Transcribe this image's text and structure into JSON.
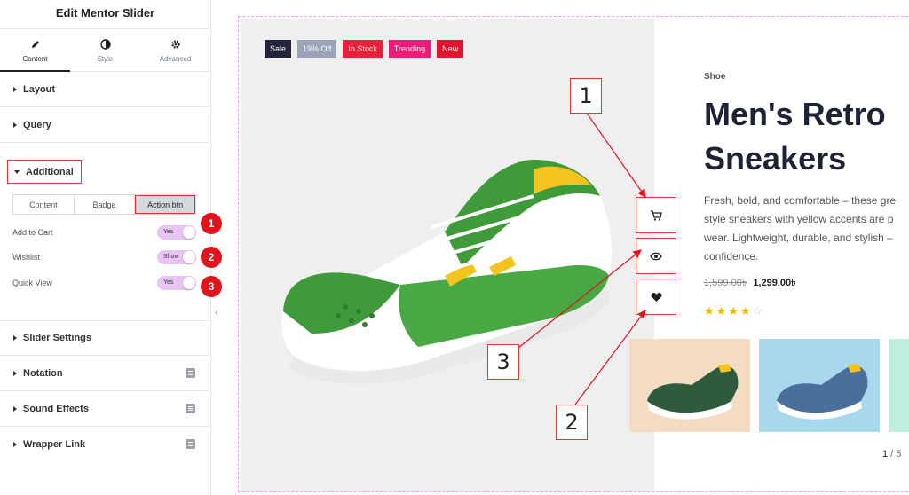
{
  "panel": {
    "title": "Edit Mentor Slider",
    "tabs": [
      {
        "label": "Content",
        "icon": "pencil-icon",
        "active": true
      },
      {
        "label": "Style",
        "icon": "contrast-icon",
        "active": false
      },
      {
        "label": "Advanced",
        "icon": "gear-icon",
        "active": false
      }
    ],
    "sections": {
      "layout": "Layout",
      "query": "Query",
      "additional": "Additional",
      "slider_settings": "Slider Settings",
      "notation": "Notation",
      "sound_effects": "Sound Effects",
      "wrapper_link": "Wrapper Link"
    },
    "subtabs": [
      "Content",
      "Badge",
      "Action btn"
    ],
    "controls": {
      "add_to_cart": {
        "label": "Add to Cart",
        "value": "Yes",
        "marker": "1"
      },
      "wishlist": {
        "label": "Wishlist",
        "value": "Show",
        "marker": "2"
      },
      "quick_view": {
        "label": "Quick View",
        "value": "Yes",
        "marker": "3"
      }
    },
    "collapse_glyph": "‹"
  },
  "preview": {
    "badges": [
      {
        "label": "Sale",
        "color": "#23233a"
      },
      {
        "label": "19% Off",
        "color": "#9aa3b8"
      },
      {
        "label": "In Stock",
        "color": "#e8213a"
      },
      {
        "label": "Trending",
        "color": "#ee1c79"
      },
      {
        "label": "New",
        "color": "#df1530"
      }
    ],
    "product": {
      "category": "Shoe",
      "title_line1": "Men's Retro",
      "title_line2": "Sneakers",
      "desc_lines": [
        "Fresh, bold, and comfortable – these gre",
        "style sneakers with yellow accents are p",
        "wear. Lightweight, durable, and stylish –",
        "confidence."
      ],
      "old_price": "1,599.00৳",
      "new_price": "1,299.00৳",
      "rating": 4,
      "rating_max": 5
    },
    "actions": [
      "cart-icon",
      "eye-icon",
      "heart-icon"
    ],
    "pager": {
      "current": "1",
      "sep": " / ",
      "total": "5"
    }
  },
  "annotations": [
    "1",
    "2",
    "3"
  ]
}
